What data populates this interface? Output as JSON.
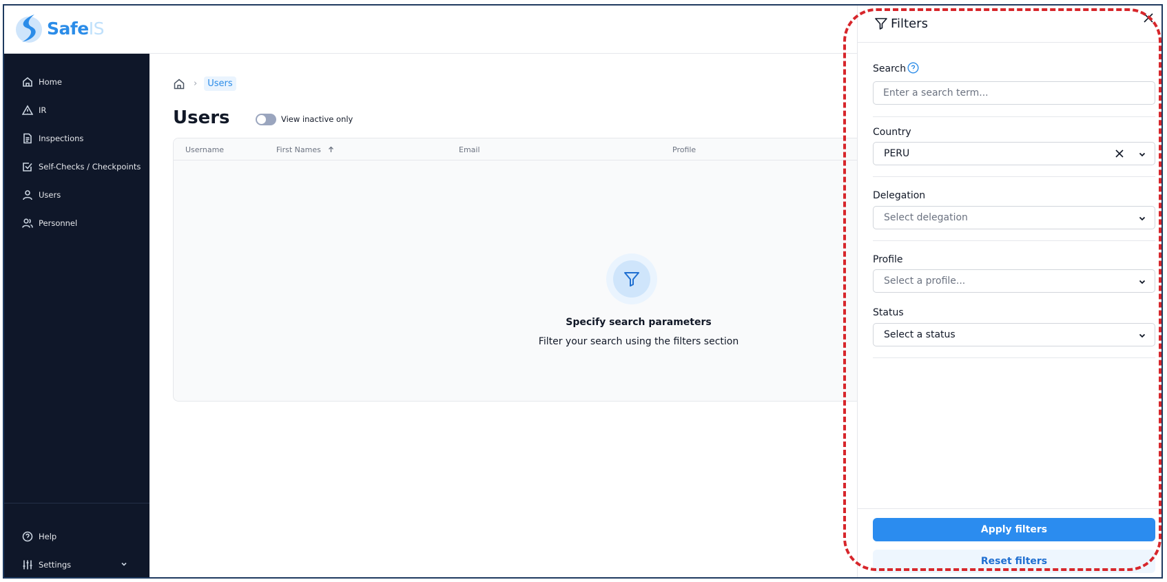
{
  "brand": {
    "name": "Safe",
    "suffix": "IS",
    "accent": "#2b8ce8"
  },
  "sidebar": {
    "items": [
      {
        "label": "Home",
        "icon": "home-icon"
      },
      {
        "label": "IR",
        "icon": "warning-icon"
      },
      {
        "label": "Inspections",
        "icon": "document-icon"
      },
      {
        "label": "Self-Checks / Checkpoints",
        "icon": "checkbox-icon"
      },
      {
        "label": "Users",
        "icon": "user-icon"
      },
      {
        "label": "Personnel",
        "icon": "users-icon"
      }
    ],
    "bottom": [
      {
        "label": "Help",
        "icon": "help-circle-icon"
      },
      {
        "label": "Settings",
        "icon": "sliders-icon"
      }
    ]
  },
  "breadcrumb": {
    "current": "Users"
  },
  "page": {
    "title": "Users",
    "toggle_label": "View inactive only"
  },
  "table": {
    "columns": [
      "Username",
      "First Names",
      "Email",
      "Profile"
    ]
  },
  "empty_state": {
    "title": "Specify search parameters",
    "subtitle": "Filter your search using the filters section"
  },
  "filters": {
    "title": "Filters",
    "search": {
      "label": "Search",
      "placeholder": "Enter a search term..."
    },
    "country": {
      "label": "Country",
      "value": "PERU"
    },
    "delegation": {
      "label": "Delegation",
      "placeholder": "Select delegation"
    },
    "profile": {
      "label": "Profile",
      "placeholder": "Select a profile..."
    },
    "status": {
      "label": "Status",
      "placeholder": "Select a status"
    },
    "apply_label": "Apply filters",
    "reset_label": "Reset filters"
  }
}
